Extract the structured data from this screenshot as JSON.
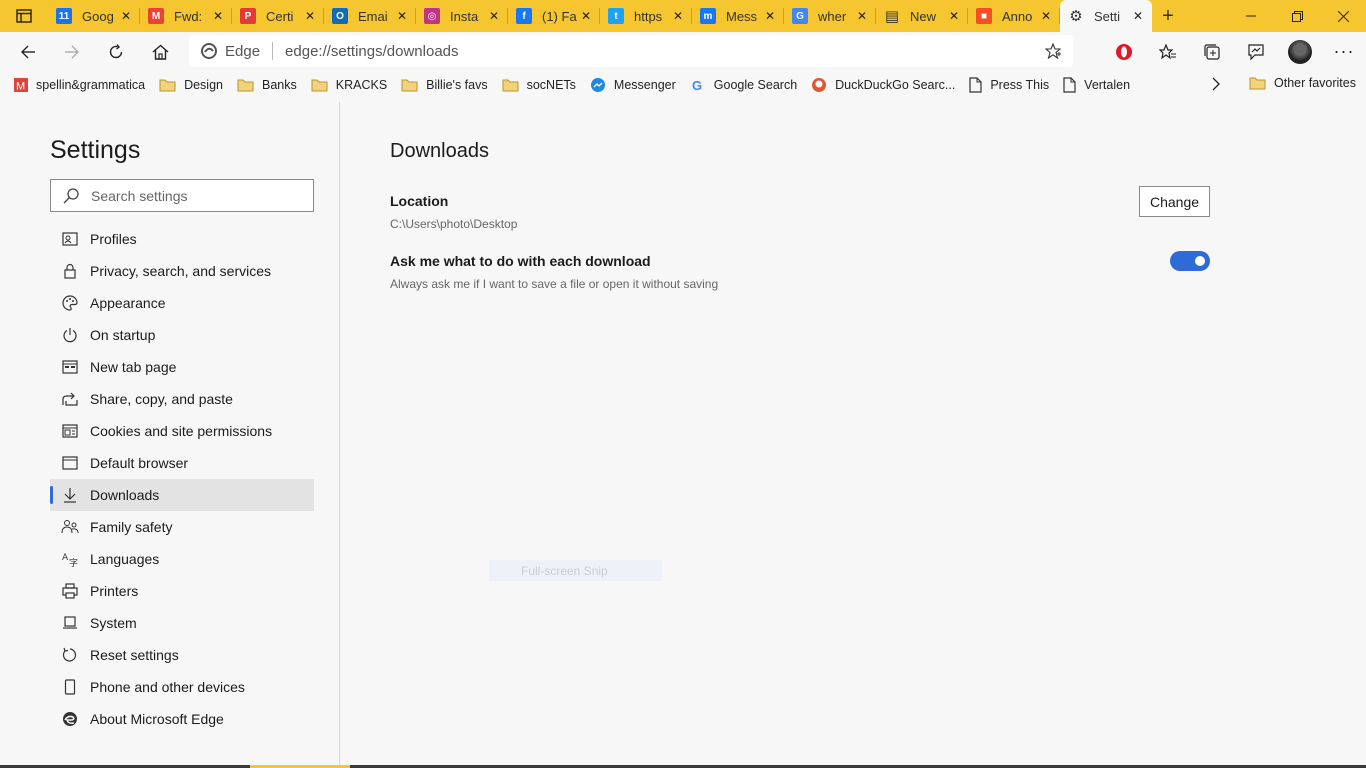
{
  "tabs": [
    {
      "title": "Goog",
      "icon": "google-calendar-icon",
      "color": "#1a73e8",
      "glyph": "11"
    },
    {
      "title": "Fwd:",
      "icon": "gmail-icon",
      "color": "#ea4335",
      "glyph": "M"
    },
    {
      "title": "Certi",
      "icon": "pdf-icon",
      "color": "#e53935",
      "glyph": "P"
    },
    {
      "title": "Emai",
      "icon": "outlook-icon",
      "color": "#0f6cbd",
      "glyph": "O"
    },
    {
      "title": "Insta",
      "icon": "instagram-icon",
      "color": "#c13584",
      "glyph": "◎"
    },
    {
      "title": "(1) Fa",
      "icon": "facebook-icon",
      "color": "#1877f2",
      "glyph": "f"
    },
    {
      "title": "https",
      "icon": "twitter-icon",
      "color": "#1da1f2",
      "glyph": "t"
    },
    {
      "title": "Mess",
      "icon": "messenger-icon",
      "color": "#1877f2",
      "glyph": "m"
    },
    {
      "title": "wher",
      "icon": "google-icon",
      "color": "#4285f4",
      "glyph": "G"
    },
    {
      "title": "New",
      "icon": "news-icon",
      "color": "#333333",
      "glyph": "▤"
    },
    {
      "title": "Anno",
      "icon": "microsoft-icon",
      "color": "#f25022",
      "glyph": "■"
    },
    {
      "title": "Setti",
      "icon": "gear-icon",
      "color": "#333333",
      "glyph": "⚙"
    }
  ],
  "address": {
    "badge": "Edge",
    "url": "edge://settings/downloads"
  },
  "favorites": [
    {
      "label": "spellin&grammatica",
      "icon": "m-red-icon"
    },
    {
      "label": "Design",
      "icon": "folder-icon"
    },
    {
      "label": "Banks",
      "icon": "folder-icon"
    },
    {
      "label": "KRACKS",
      "icon": "folder-icon"
    },
    {
      "label": "Billie's favs",
      "icon": "folder-icon"
    },
    {
      "label": "socNETs",
      "icon": "folder-icon"
    },
    {
      "label": "Messenger",
      "icon": "messenger-icon"
    },
    {
      "label": "Google Search",
      "icon": "google-icon"
    },
    {
      "label": "DuckDuckGo Searc...",
      "icon": "duckduckgo-icon"
    },
    {
      "label": "Press This",
      "icon": "page-icon"
    },
    {
      "label": "Vertalen",
      "icon": "page-icon"
    }
  ],
  "other_favorites": "Other favorites",
  "sidebar": {
    "title": "Settings",
    "search_placeholder": "Search settings",
    "items": [
      {
        "label": "Profiles",
        "icon": "profile-icon"
      },
      {
        "label": "Privacy, search, and services",
        "icon": "lock-icon"
      },
      {
        "label": "Appearance",
        "icon": "palette-icon"
      },
      {
        "label": "On startup",
        "icon": "power-icon"
      },
      {
        "label": "New tab page",
        "icon": "newtab-icon"
      },
      {
        "label": "Share, copy, and paste",
        "icon": "share-icon"
      },
      {
        "label": "Cookies and site permissions",
        "icon": "cookies-icon"
      },
      {
        "label": "Default browser",
        "icon": "browser-icon"
      },
      {
        "label": "Downloads",
        "icon": "download-icon",
        "selected": true
      },
      {
        "label": "Family safety",
        "icon": "family-icon"
      },
      {
        "label": "Languages",
        "icon": "language-icon"
      },
      {
        "label": "Printers",
        "icon": "printer-icon"
      },
      {
        "label": "System",
        "icon": "system-icon"
      },
      {
        "label": "Reset settings",
        "icon": "reset-icon"
      },
      {
        "label": "Phone and other devices",
        "icon": "phone-icon"
      },
      {
        "label": "About Microsoft Edge",
        "icon": "edge-icon"
      }
    ]
  },
  "main": {
    "heading": "Downloads",
    "location_label": "Location",
    "location_path": "C:\\Users\\photo\\Desktop",
    "change_button": "Change",
    "ask_label": "Ask me what to do with each download",
    "ask_desc": "Always ask me if I want to save a file or open it without saving",
    "ask_enabled": true
  },
  "snip_overlay": "Full-screen Snip",
  "colors": {
    "tabstrip": "#f6c630",
    "accent": "#2f6bd6"
  }
}
